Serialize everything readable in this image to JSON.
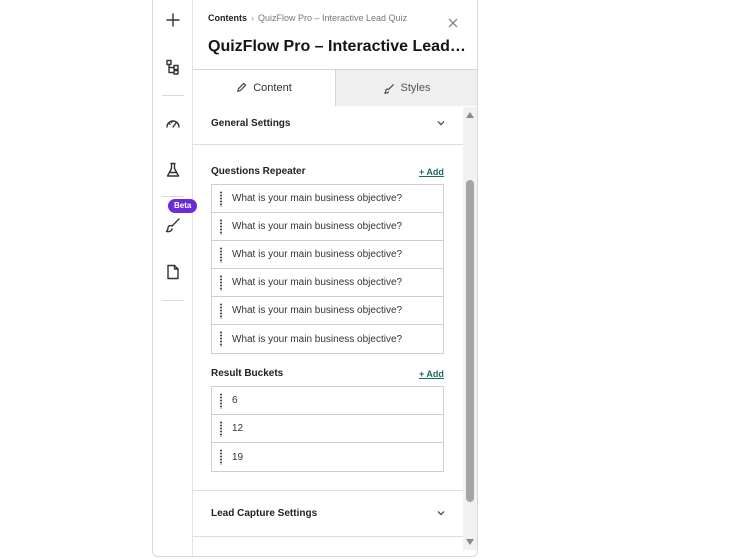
{
  "rail": {
    "items": [
      {
        "name": "plus-icon"
      },
      {
        "name": "structure-icon"
      },
      {
        "name": "gauge-icon"
      },
      {
        "name": "flask-icon"
      },
      {
        "name": "brush-icon"
      },
      {
        "name": "page-icon"
      }
    ],
    "beta_badge": "Beta"
  },
  "breadcrumb": {
    "root": "Contents",
    "current": "QuizFlow Pro – Interactive Lead Quiz"
  },
  "title": "QuizFlow Pro – Interactive Lead Quiz",
  "tabs": [
    {
      "label": "Content",
      "icon": "pencil-icon",
      "active": true
    },
    {
      "label": "Styles",
      "icon": "brush-icon",
      "active": false
    }
  ],
  "sections": {
    "general": "General Settings",
    "lead_capture": "Lead Capture Settings"
  },
  "questions": {
    "label": "Questions Repeater",
    "add_label": "+ Add",
    "items": [
      "What is your main business objective?",
      "What is your main business objective?",
      "What is your main business objective?",
      "What is your main business objective?",
      "What is your main business objective?",
      "What is your main business objective?"
    ]
  },
  "results": {
    "label": "Result Buckets",
    "add_label": "+ Add",
    "items": [
      "6",
      "12",
      "19"
    ]
  },
  "colors": {
    "accent_link": "#1b6b63",
    "beta_badge": "#6b2bd9"
  }
}
